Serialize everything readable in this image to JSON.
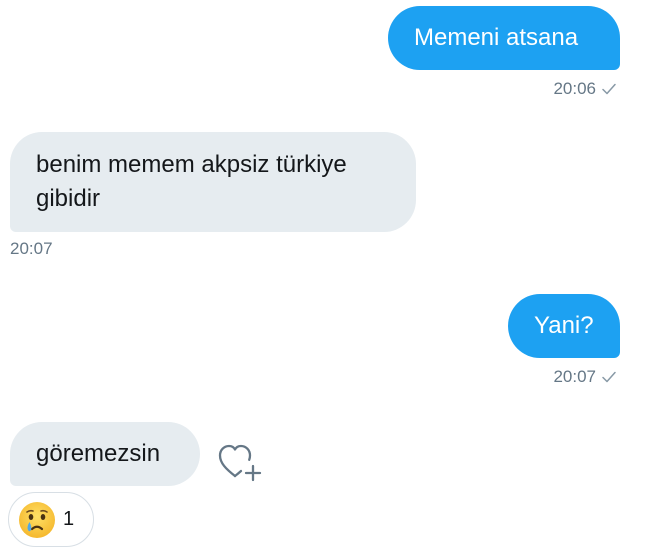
{
  "messages": [
    {
      "direction": "sent",
      "text": "Memeni atsana",
      "time": "20:06"
    },
    {
      "direction": "received",
      "text_line1": "benim memem akpsiz türkiye",
      "text_line2": "gibidir",
      "time": "20:07"
    },
    {
      "direction": "sent",
      "text": "Yani?",
      "time": "20:07"
    },
    {
      "direction": "received",
      "text": "göremezsin"
    }
  ],
  "reaction": {
    "emoji": "crying-face",
    "count": "1"
  },
  "icons": {
    "read_receipt": "check-icon",
    "add_reaction": "heart-plus-icon"
  },
  "colors": {
    "sent_bubble": "#1DA1F2",
    "received_bubble": "#E6ECF0",
    "meta_text": "#657786"
  }
}
